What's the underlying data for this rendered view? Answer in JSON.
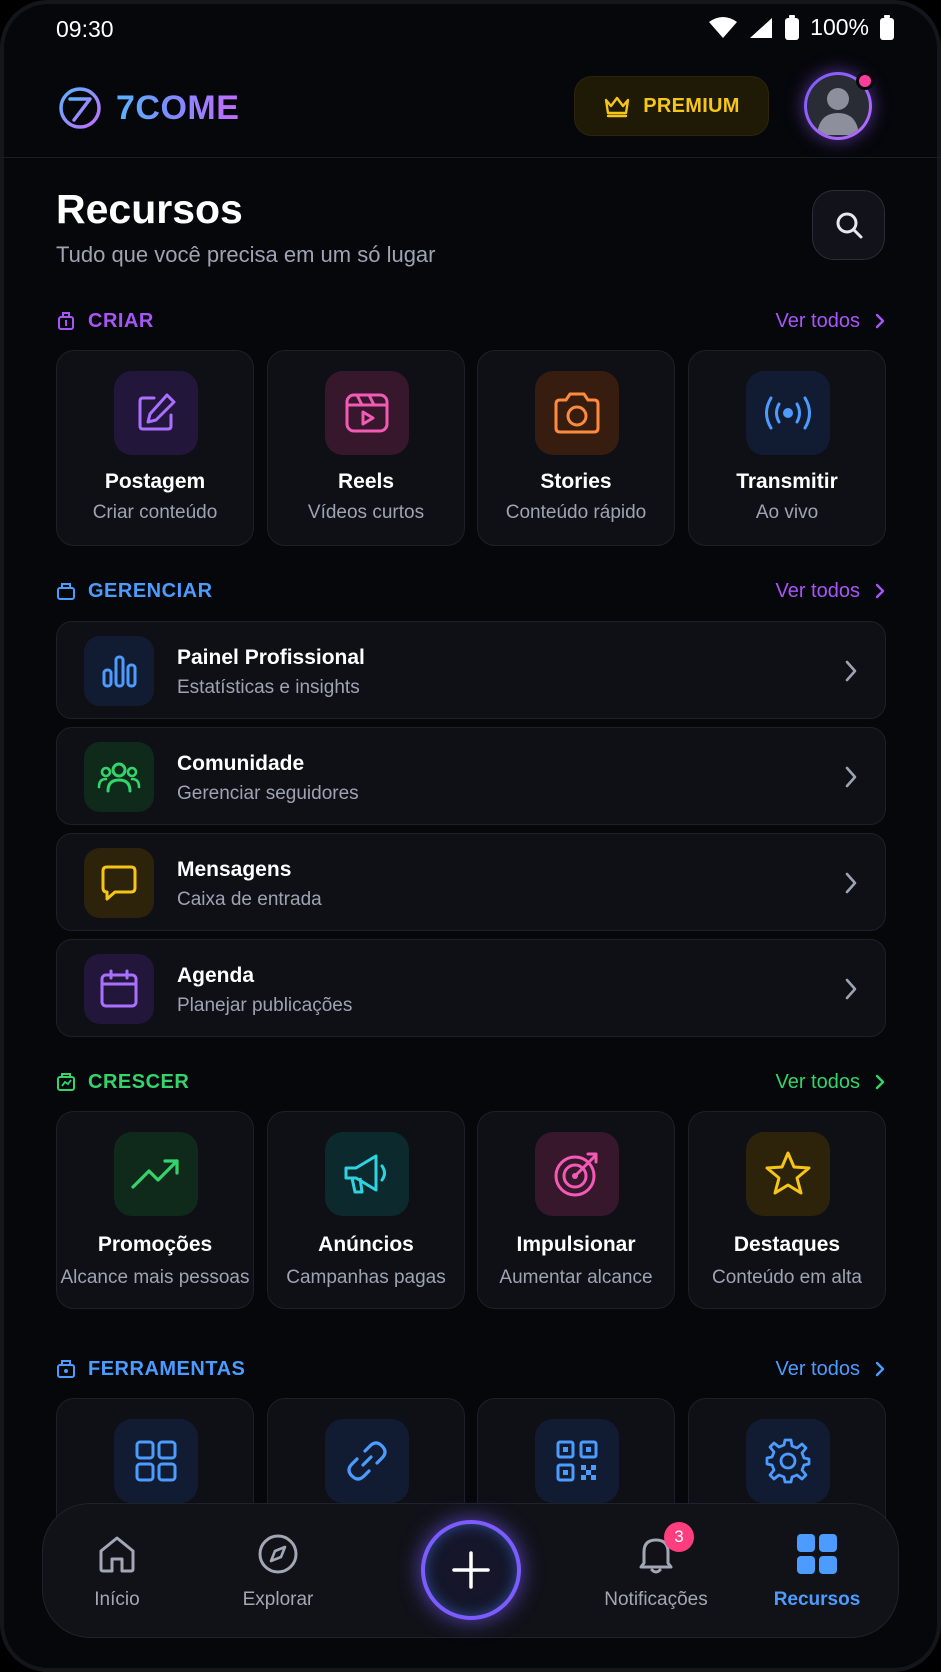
{
  "status_bar": {
    "time": "09:30",
    "battery_pct": "100%"
  },
  "header": {
    "app_name": "7COME",
    "premium_label": "PREMIUM",
    "avatar_icon": "user-icon"
  },
  "page": {
    "title": "Recursos",
    "subtitle": "Tudo que você precisa em um só lugar"
  },
  "sections": {
    "criar": {
      "label": "CRIAR",
      "more": "Ver todos",
      "color": "#a855f7",
      "items": [
        {
          "title": "Postagem",
          "subtitle": "Criar conteúdo",
          "icon": "edit-icon",
          "color": "#a970ff"
        },
        {
          "title": "Reels",
          "subtitle": "Vídeos curtos",
          "icon": "video-play-icon",
          "color": "#f25ab6"
        },
        {
          "title": "Stories",
          "subtitle": "Conteúdo rápido",
          "icon": "camera-icon",
          "color": "#ff8a3d"
        },
        {
          "title": "Transmitir",
          "subtitle": "Ao vivo",
          "icon": "broadcast-icon",
          "color": "#4c9bff"
        }
      ]
    },
    "gerenciar": {
      "label": "GERENCIAR",
      "more": "Ver todos",
      "color": "#4c9bff",
      "items": [
        {
          "title": "Painel Profissional",
          "subtitle": "Estatísticas e insights",
          "icon": "bar-chart-icon",
          "color": "#4c9bff"
        },
        {
          "title": "Comunidade",
          "subtitle": "Gerenciar seguidores",
          "icon": "users-icon",
          "color": "#34d36b"
        },
        {
          "title": "Mensagens",
          "subtitle": "Caixa de entrada",
          "icon": "message-icon",
          "color": "#f5c518"
        },
        {
          "title": "Agenda",
          "subtitle": "Planejar publicações",
          "icon": "calendar-icon",
          "color": "#a970ff"
        }
      ]
    },
    "crescer": {
      "label": "CRESCER",
      "more": "Ver todos",
      "color": "#34d36b",
      "items": [
        {
          "title": "Promoções",
          "subtitle": "Alcance mais pessoas",
          "icon": "trending-up-icon",
          "color": "#34d36b"
        },
        {
          "title": "Anúncios",
          "subtitle": "Campanhas pagas",
          "icon": "megaphone-icon",
          "color": "#2fd3e0"
        },
        {
          "title": "Impulsionar",
          "subtitle": "Aumentar alcance",
          "icon": "target-icon",
          "color": "#f25ab6"
        },
        {
          "title": "Destaques",
          "subtitle": "Conteúdo em alta",
          "icon": "star-icon",
          "color": "#f5c518"
        }
      ]
    },
    "ferramentas": {
      "label": "FERRAMENTAS",
      "more": "Ver todos",
      "color": "#4c9bff",
      "items": [
        {
          "icon": "grid-icon"
        },
        {
          "icon": "link-icon"
        },
        {
          "icon": "qr-code-icon"
        },
        {
          "icon": "gear-icon"
        }
      ]
    }
  },
  "bottom_nav": {
    "items": [
      {
        "label": "Início",
        "icon": "home-icon"
      },
      {
        "label": "Explorar",
        "icon": "compass-icon"
      },
      {
        "label": "Notificações",
        "icon": "bell-icon",
        "badge": "3"
      },
      {
        "label": "Recursos",
        "icon": "apps-icon",
        "active": true
      }
    ],
    "fab_icon": "plus-icon"
  },
  "colors": {
    "background": "#06070b",
    "card": "#0e1016",
    "accent_blue": "#4c9bff",
    "accent_purple": "#a855f7",
    "accent_green": "#34d36b",
    "premium_gold": "#f5c518"
  }
}
